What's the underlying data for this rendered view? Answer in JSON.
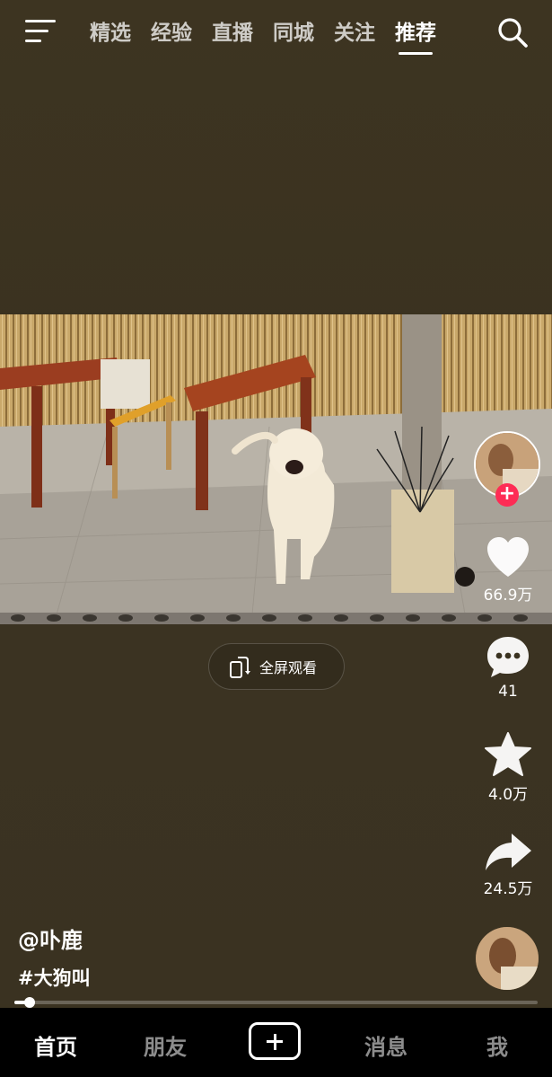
{
  "top_tabs": [
    {
      "label": "精选"
    },
    {
      "label": "经验"
    },
    {
      "label": "直播"
    },
    {
      "label": "同城"
    },
    {
      "label": "关注"
    },
    {
      "label": "推荐"
    }
  ],
  "active_tab": "推荐",
  "fullscreen_label": "全屏观看",
  "actions": {
    "likes": "66.9万",
    "comments": "41",
    "favorites": "4.0万",
    "shares": "24.5万"
  },
  "author": "@卟鹿",
  "hashtag": "#大狗叫",
  "video_progress": 0.03,
  "bottom_nav": {
    "home": "首页",
    "friends": "朋友",
    "messages": "消息",
    "me": "我"
  },
  "colors": {
    "background": "#3a3220",
    "follow_accent": "#fe2c55",
    "nav_bar": "#000000"
  }
}
